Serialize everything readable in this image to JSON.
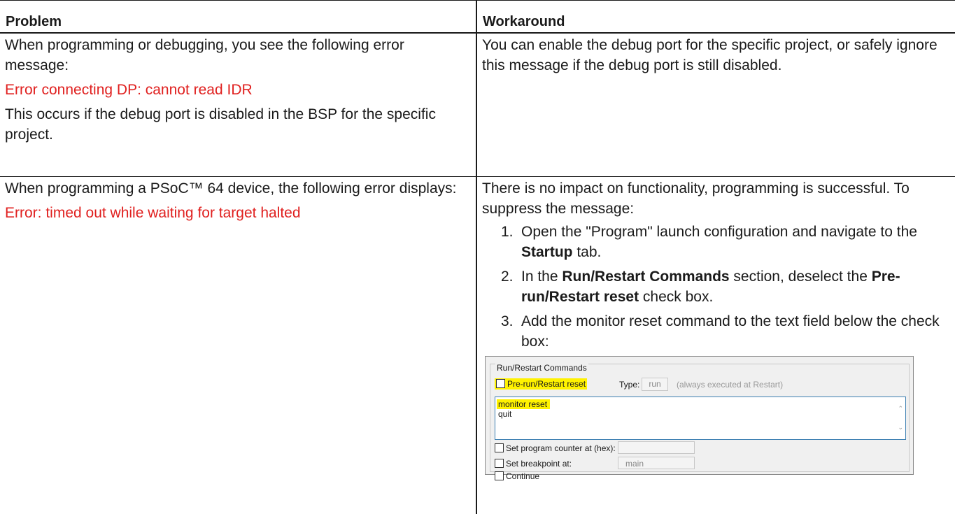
{
  "table": {
    "headers": {
      "problem": "Problem",
      "workaround": "Workaround"
    },
    "row1": {
      "problem_intro": "When programming or debugging, you see the following error message:",
      "problem_error": "Error connecting DP: cannot read IDR",
      "problem_note": "This occurs if the debug port is disabled in the BSP for the specific project.",
      "workaround": "You can enable the debug port for the specific project, or safely ignore this message if the debug port is still disabled."
    },
    "row2": {
      "problem_intro": "When programming a PSoC™ 64 device, the following error displays:",
      "problem_error": "Error: timed out while waiting for target halted",
      "workaround_intro": "There is no impact on functionality, programming is successful. To suppress the message:",
      "steps": [
        {
          "num": "1.",
          "pre": "Open the \"Program\" launch configuration and navigate to the ",
          "bold": "Startup",
          "post": " tab.",
          "bold2": "",
          "post2": ""
        },
        {
          "num": "2.",
          "pre": "In the ",
          "bold": "Run/Restart Commands",
          "post": " section, deselect the ",
          "bold2": "Pre-run/Restart reset",
          "post2": " check box."
        },
        {
          "num": "3.",
          "pre": "Add the monitor reset command to the text field below the check box:",
          "bold": "",
          "post": "",
          "bold2": "",
          "post2": ""
        }
      ]
    }
  },
  "screenshot": {
    "group_title": "Run/Restart Commands",
    "pre_run_label": "Pre-run/Restart reset",
    "type_label": "Type:",
    "type_value": "run",
    "type_hint": "(always executed at Restart)",
    "command_line1": "monitor reset",
    "command_line2": "quit",
    "set_pc_label": "Set program counter at (hex):",
    "set_pc_value": "",
    "set_bp_label": "Set breakpoint at:",
    "set_bp_value": "main",
    "continue_label": "Continue",
    "highlight_color": "#fff200"
  }
}
